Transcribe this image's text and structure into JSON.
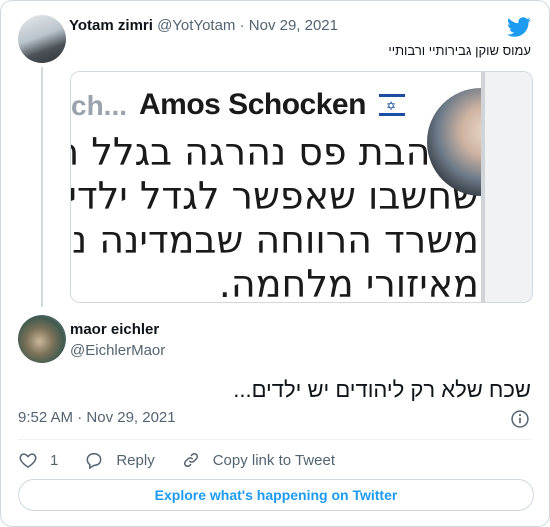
{
  "parent": {
    "display_name": "Yotam zimri",
    "handle": "@YotYotam",
    "separator": "·",
    "date": "Nov 29, 2021",
    "text": "עמוס שוקן גבירותיי ורבותיי",
    "media": {
      "truncated_name": "ch...",
      "author": "Amos Schocken",
      "lines": [
        "שלהבת פס נהרגה בגלל חו",
        "שחשבו שאפשר לגדל ילדים",
        "משרד הרווחה שבמדינה נור",
        "מאיזורי מלחמה."
      ]
    }
  },
  "reply": {
    "display_name": "maor eichler",
    "handle": "@EichlerMaor",
    "text": "שכח שלא רק ליהודים יש ילדים...",
    "time": "9:52 AM",
    "separator": "·",
    "date": "Nov 29, 2021"
  },
  "actions": {
    "like_count": "1",
    "reply_label": "Reply",
    "copy_label": "Copy link to Tweet"
  },
  "explore_label": "Explore what's happening on Twitter",
  "colors": {
    "brand": "#1d9bf0",
    "text": "#0f1419",
    "muted": "#536471",
    "border": "#cfd9de"
  }
}
